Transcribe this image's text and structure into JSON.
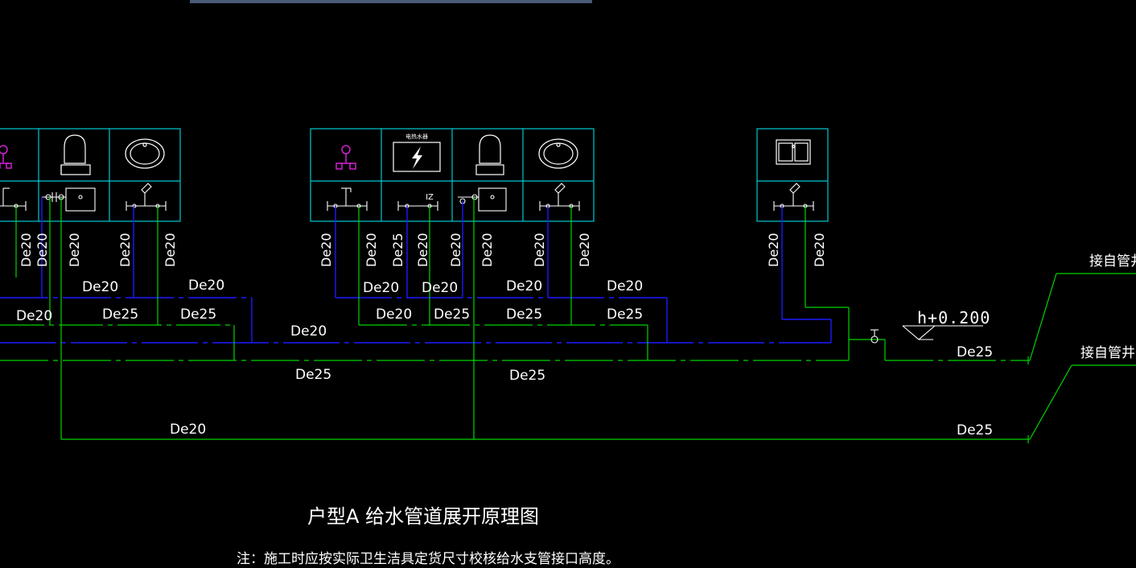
{
  "colors": {
    "background": "#000000",
    "cold_pipe": "#1a1aff",
    "hot_pipe": "#00d400",
    "fixture_frame": "#00c8d2",
    "fixture_symbol": "#ffffff",
    "mixer_symbol": "#d020d0",
    "text": "#ffffff"
  },
  "fixtures": [
    {
      "icon": "shower-mixer-icon"
    },
    {
      "icon": "toilet-icon"
    },
    {
      "icon": "washbasin-icon"
    },
    {
      "icon": "shower-mixer-icon"
    },
    {
      "icon": "electric-water-heater-icon",
      "label": "电热水器"
    },
    {
      "icon": "toilet-icon"
    },
    {
      "icon": "washbasin-icon"
    },
    {
      "icon": "kitchen-sink-icon"
    }
  ],
  "riser_labels": [
    "De20",
    "De20",
    "De20",
    "De20",
    "De20",
    "De20",
    "De20",
    "De25",
    "De20",
    "De20",
    "De20",
    "De20",
    "De20",
    "De20",
    "De20"
  ],
  "pipe_labels": {
    "cold_branch_a": "De20",
    "cold_branch_b": "De20",
    "hot_branch_a": "De20",
    "hot_branch_b": "De25",
    "hot_branch_c": "De25",
    "cold_main_mid": "De20",
    "cold_branch_c": "De20",
    "cold_branch_d": "De20",
    "cold_branch_e": "De20",
    "cold_branch_f": "De20",
    "hot_branch_d": "De20",
    "hot_branch_e": "De25",
    "hot_branch_f": "De25",
    "hot_branch_g": "De25",
    "hot_main_a": "De25",
    "hot_main_b": "De25",
    "main_right": "De25",
    "bottom_left": "De20",
    "bottom_right": "De25"
  },
  "wall_tag": "IZ",
  "elevation": "h+0.200",
  "sources": {
    "top": "接自管井",
    "bottom": "接自管井分"
  },
  "title": "户型A  给水管道展开原理图",
  "note": "注：施工时应按实际卫生洁具定货尺寸校核给水支管接口高度。"
}
